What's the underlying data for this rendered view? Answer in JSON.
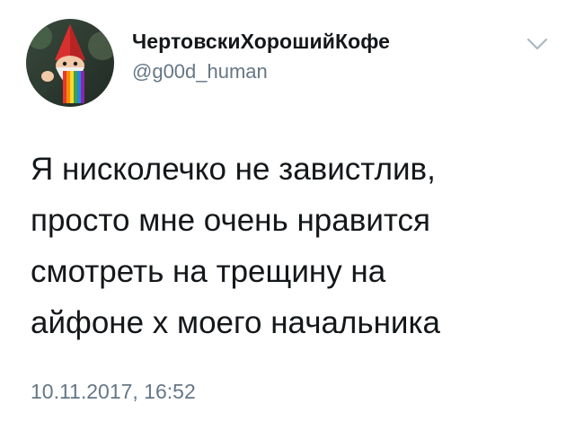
{
  "tweet": {
    "author": {
      "display_name": "ЧертовскиХорошийКофе",
      "handle": "@g00d_human",
      "avatar_icon": "gnome-avatar-icon"
    },
    "text": "Я нисколечко не завистлив,\nпросто мне очень нравится\nсмотреть на трещину на\nайфоне х моего начальника",
    "timestamp": "10.11.2017, 16:52",
    "menu_icon": "chevron-down-icon"
  },
  "colors": {
    "text_primary": "#14171a",
    "text_secondary": "#657786",
    "chevron": "#aab8c2"
  }
}
